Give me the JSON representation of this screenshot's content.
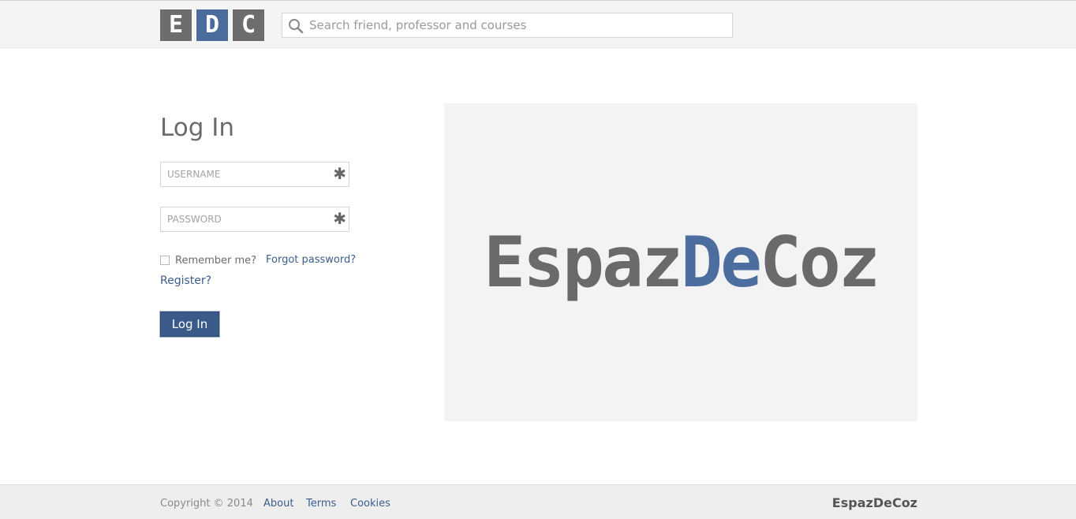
{
  "header": {
    "logo_letters": [
      "E",
      "D",
      "C"
    ],
    "search_placeholder": "Search friend, professor and courses"
  },
  "login": {
    "title": "Log In",
    "username_placeholder": "USERNAME",
    "password_placeholder": "PASSWORD",
    "required_marker": "✱",
    "remember_label": "Remember me?",
    "remember_checked": false,
    "forgot_label": "Forgot password?",
    "register_label": "Register?",
    "submit_label": "Log In"
  },
  "hero": {
    "wordmark_part1": "Espaz",
    "wordmark_part2": "De",
    "wordmark_part3": "Coz"
  },
  "footer": {
    "copyright": "Copyright © 2014",
    "links": [
      "About",
      "Terms",
      "Cookies"
    ],
    "brand": "EspazDeCoz"
  },
  "colors": {
    "brand_blue": "#4a6d9c",
    "brand_gray": "#6d6d6d",
    "link_blue": "#3b5e8c",
    "button_blue": "#3a5b8a"
  }
}
